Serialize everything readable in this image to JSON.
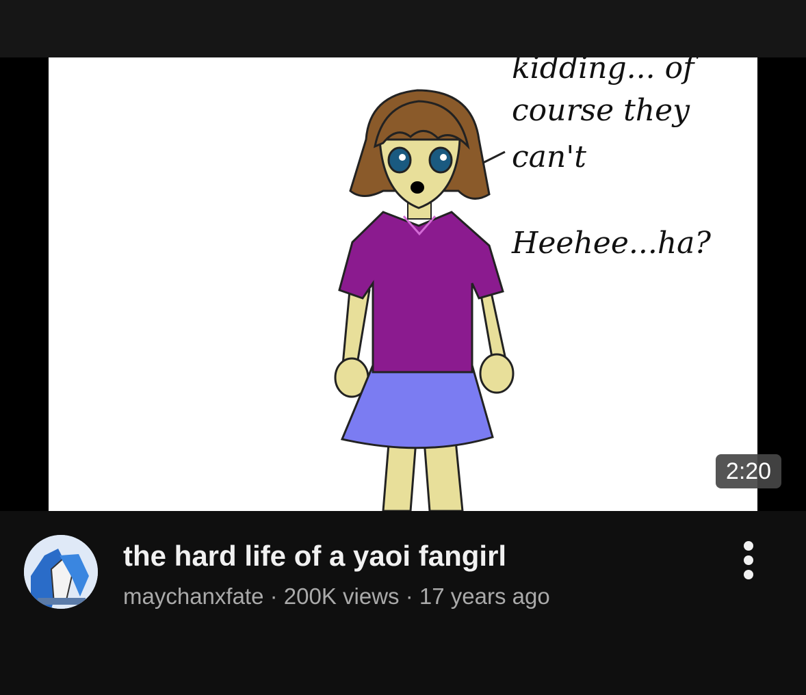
{
  "video": {
    "thumbnail_caption": {
      "line1": "kidding... of",
      "line2": "course they",
      "line3": "can't",
      "line4": "Heehee...ha?"
    },
    "duration": "2:20",
    "title": "the hard life of a yaoi fangirl",
    "channel": "maychanxfate",
    "separator": " · ",
    "views": "200K views",
    "age": "17 years ago",
    "menu_icon": "more-vertical-icon"
  },
  "colors": {
    "background": "#0f0f0f",
    "title_text": "#f1f1f1",
    "meta_text": "#aaaaaa",
    "duration_badge": "#464646"
  }
}
